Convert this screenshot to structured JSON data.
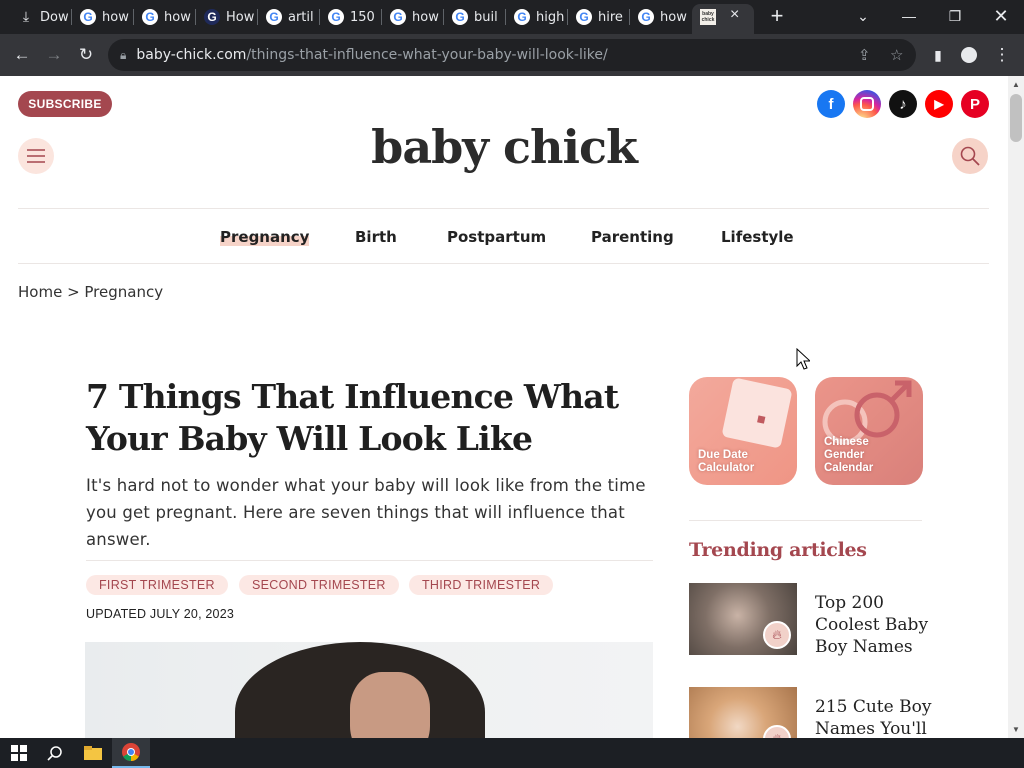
{
  "browser": {
    "tabs": [
      {
        "label": "Dow",
        "icon": "download-icon"
      },
      {
        "label": "how",
        "icon": "google-icon"
      },
      {
        "label": "how",
        "icon": "google-icon"
      },
      {
        "label": "How",
        "icon": "g-icon"
      },
      {
        "label": "artil",
        "icon": "google-icon"
      },
      {
        "label": "150",
        "icon": "google-icon"
      },
      {
        "label": "how",
        "icon": "google-icon"
      },
      {
        "label": "buil",
        "icon": "google-icon"
      },
      {
        "label": "high",
        "icon": "google-icon"
      },
      {
        "label": "hire",
        "icon": "google-icon"
      },
      {
        "label": "how",
        "icon": "google-icon"
      }
    ],
    "active_tab_favicon_text": "baby chick",
    "url_host": "baby-chick.com",
    "url_path": "/things-that-influence-what-your-baby-will-look-like/"
  },
  "header": {
    "subscribe_label": "SUBSCRIBE",
    "logo": "baby chick",
    "social": [
      {
        "name": "facebook-icon",
        "glyph": "f",
        "color": "#1877f2"
      },
      {
        "name": "instagram-icon",
        "glyph": "◎",
        "color": "#d6249f"
      },
      {
        "name": "tiktok-icon",
        "glyph": "♪",
        "color": "#111111"
      },
      {
        "name": "youtube-icon",
        "glyph": "▶",
        "color": "#ff0000"
      },
      {
        "name": "pinterest-icon",
        "glyph": "P",
        "color": "#e60023"
      }
    ]
  },
  "nav": {
    "items": [
      "Pregnancy",
      "Birth",
      "Postpartum",
      "Parenting",
      "Lifestyle"
    ]
  },
  "breadcrumb": "Home > Pregnancy",
  "article": {
    "title": "7 Things That Influence What Your Baby Will Look Like",
    "dek": "It's hard not to wonder what your baby will look like from the time you get pregnant. Here are seven things that will influence that answer.",
    "tags": [
      "FIRST TRIMESTER",
      "SECOND TRIMESTER",
      "THIRD TRIMESTER"
    ],
    "updated": "UPDATED JULY 20, 2023"
  },
  "sidebar": {
    "tools": [
      {
        "label": "Due Date Calculator"
      },
      {
        "label": "Chinese Gender Calendar"
      }
    ],
    "trending_title": "Trending articles",
    "trending": [
      {
        "title": "Top 200 Coolest Baby Boy Names"
      },
      {
        "title": "215 Cute Boy Names You'll"
      }
    ]
  },
  "colors": {
    "brand": "#a4474f",
    "accent_soft": "#fce8e4"
  }
}
